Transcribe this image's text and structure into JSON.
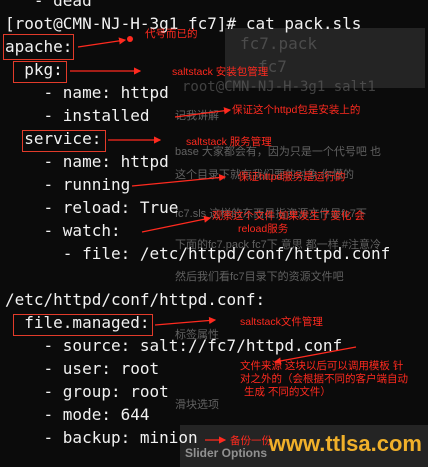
{
  "terminal": {
    "lines": [
      "   - dead",
      "[root@CMN-NJ-H-3g1 fc7]# cat pack.sls",
      "apache:",
      "  pkg:",
      "    - name: httpd",
      "    - installed",
      "  service:",
      "    - name: httpd",
      "    - running",
      "    - reload: True",
      "    - watch:",
      "      - file: /etc/httpd/conf/httpd.conf",
      "",
      "/etc/httpd/conf/httpd.conf:",
      "  file.managed:",
      "    - source: salt://fc7/httpd.conf",
      "    - user: root",
      "    - group: root",
      "    - mode: 644",
      "    - backup: minion"
    ]
  },
  "annotations": {
    "apache": "代号而已的",
    "pkg": "saltstack 安装包管理",
    "installed": "保证这个httpd包是安装上的",
    "service": "saltstack 服务管理",
    "running": "保证httpd服务是运行的",
    "watch_1": "观察这个文件 如果发生了变化 会",
    "watch_2": "reload服务",
    "file_managed": "saltstack文件管理",
    "source_1": "文件来源 这块以后可以调用模板 针",
    "source_2": "对之外的（会根据不同的客户端自动",
    "source_3": "生成 不同的文件）",
    "backup": "备份一份"
  },
  "watermark": "www.ttlsa.com",
  "background_text": {
    "t1": "fc7.pack",
    "t2": "fc7",
    "t3": "root@CMN-NJ-H-3g1 salt1",
    "t4": "记我讲解",
    "t5": "base 大家都会有，因为只是一个代号吧 也",
    "t6": "这个目录下就有我们要的对象 你懂的",
    "t7": "fc7.sls 这样的东西是指资源文件是fc7下",
    "t8": "下面的fc7.pack fc7下 意思 都一样 #注意冷",
    "t9": "然后我们看fc7目录下的资源文件吧",
    "t10": "标签属性",
    "t11": "滑块选项",
    "t12": "Slider Options"
  }
}
